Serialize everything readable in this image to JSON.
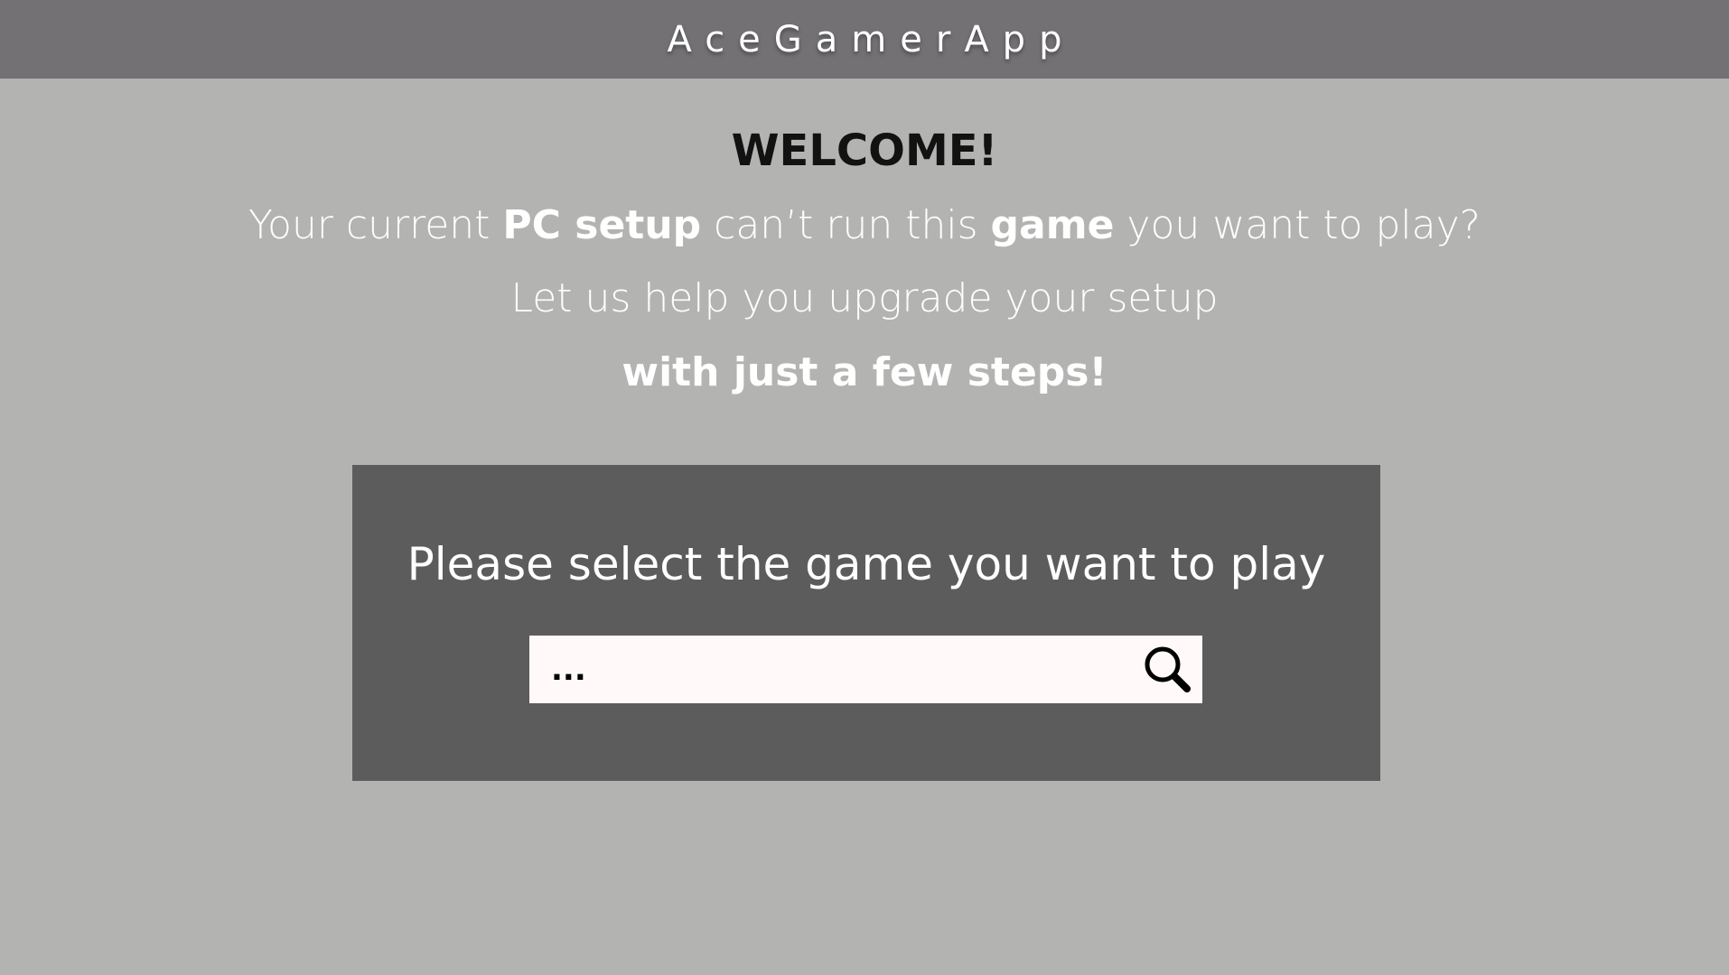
{
  "header": {
    "app_title": "AceGamerApp"
  },
  "welcome": {
    "title": "WELCOME!",
    "line1": {
      "part1": "Your current ",
      "bold1": "PC setup",
      "part2": " can’t run this ",
      "bold2": "game",
      "part3": " you want to play?"
    },
    "line2": "Let us help you upgrade your setup",
    "line3": "with just a few steps!"
  },
  "game_select": {
    "prompt": "Please select the game you want to play",
    "search_placeholder": "...",
    "search_icon": "search-icon"
  },
  "colors": {
    "page_background": "#b3b3b1",
    "header_background": "#737174",
    "panel_background": "#5c5c5c",
    "search_background": "#fffaf9"
  }
}
